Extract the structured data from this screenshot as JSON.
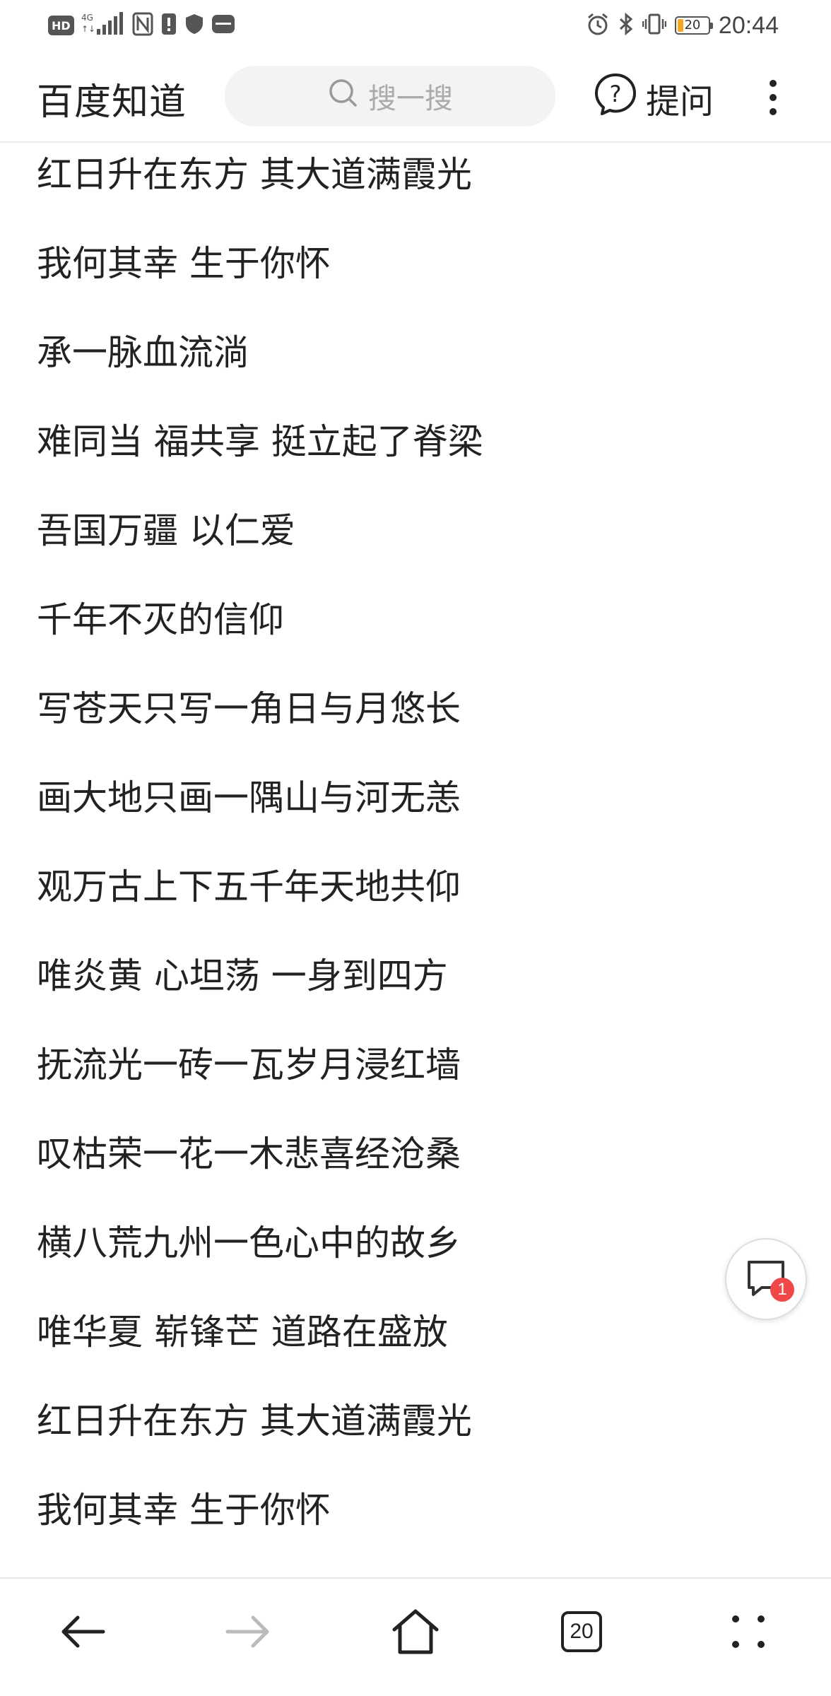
{
  "status_bar": {
    "left_badges": [
      "HD",
      "4G"
    ],
    "time": "20:44",
    "battery_level": "20",
    "battery_fraction": 0.2,
    "icons": [
      "hd-icon",
      "signal-icon",
      "nfc-icon",
      "alert-icon",
      "shield-icon",
      "huawei-icon",
      "alarm-icon",
      "bluetooth-icon",
      "vibrate-icon",
      "battery-icon"
    ]
  },
  "header": {
    "brand": "百度知道",
    "search_placeholder": "搜一搜",
    "ask_label": "提问"
  },
  "lyrics": [
    "红日升在东方 其大道满霞光",
    "我何其幸 生于你怀",
    "承一脉血流淌",
    "难同当 福共享 挺立起了脊梁",
    "吾国万疆 以仁爱",
    "千年不灭的信仰",
    "写苍天只写一角日与月悠长",
    "画大地只画一隅山与河无恙",
    "观万古上下五千年天地共仰",
    "唯炎黄 心坦荡 一身到四方",
    "抚流光一砖一瓦岁月浸红墙",
    "叹枯荣一花一木悲喜经沧桑",
    "横八荒九州一色心中的故乡",
    "唯华夏 崭锋芒 道路在盛放",
    "红日升在东方 其大道满霞光",
    "我何其幸 生于你怀"
  ],
  "floating_button": {
    "badge_count": "1"
  },
  "bottom_nav": {
    "tabs_count": "20",
    "items": [
      "back-icon",
      "forward-icon",
      "home-icon",
      "tabs-icon",
      "menu-icon"
    ]
  }
}
